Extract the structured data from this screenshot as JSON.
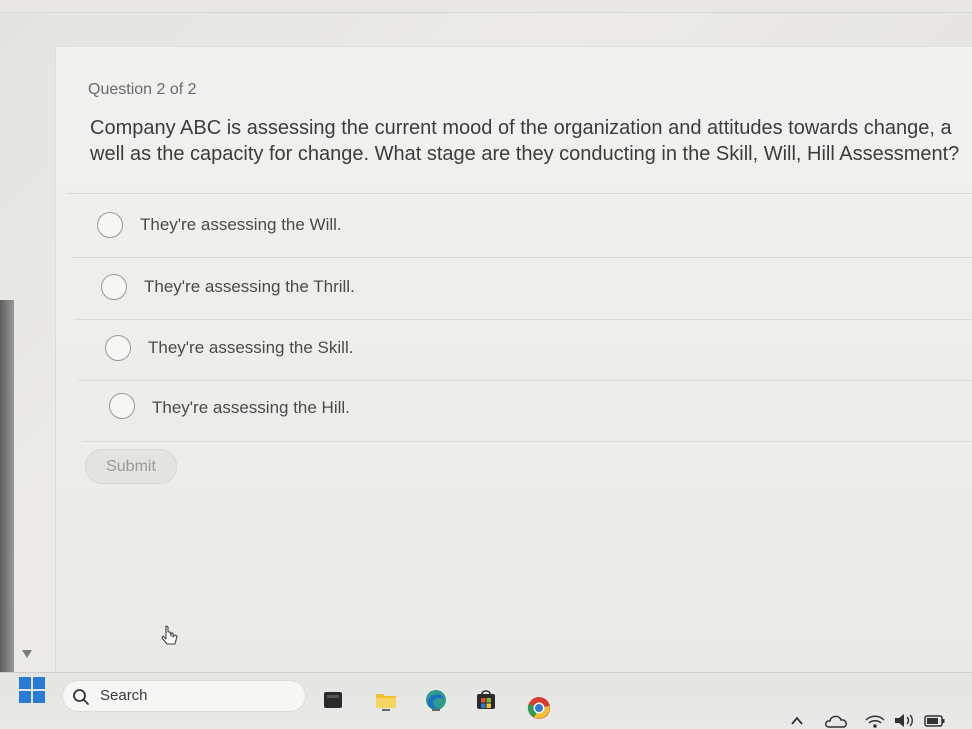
{
  "question": {
    "counter": "Question 2 of 2",
    "text_line1": "Company ABC is assessing the current mood of the organization and attitudes towards change, a",
    "text_line2": "well as the capacity for change. What stage are they conducting in the Skill, Will, Hill Assessment?"
  },
  "options": [
    {
      "label": "They're assessing the Will."
    },
    {
      "label": "They're assessing the Thrill."
    },
    {
      "label": "They're assessing the Skill."
    },
    {
      "label": "They're assessing the Hill."
    }
  ],
  "submit": {
    "label": "Submit"
  },
  "taskbar": {
    "search_label": "Search",
    "apps": [
      "file-explorer-icon",
      "folder-icon",
      "edge-icon",
      "store-icon",
      "chrome-icon"
    ],
    "tray": [
      "chevron-up-icon",
      "onedrive-icon",
      "wifi-icon",
      "volume-icon",
      "battery-icon"
    ]
  },
  "colors": {
    "accent_blue": "#2a7bd8",
    "chrome_red": "#d93b30",
    "chrome_yellow": "#f2c230",
    "chrome_green": "#2e9d4f"
  }
}
